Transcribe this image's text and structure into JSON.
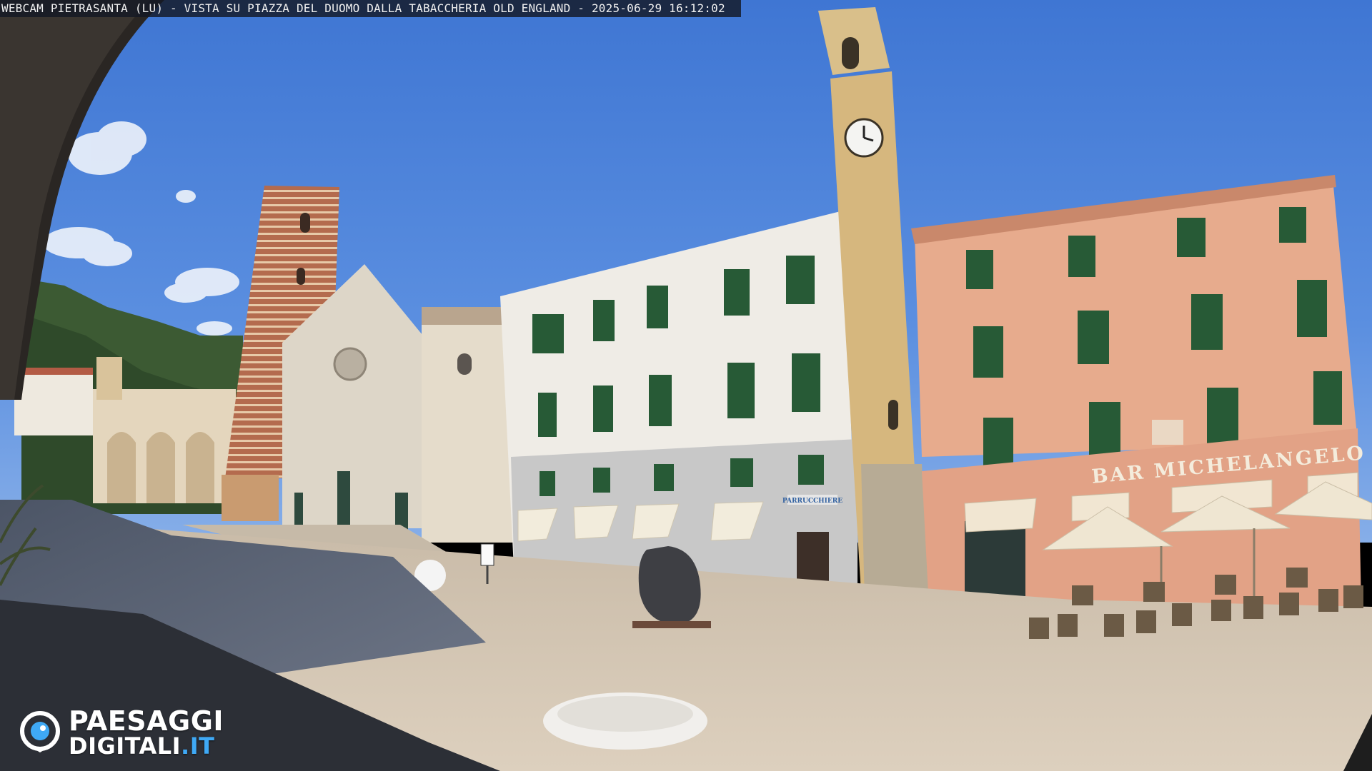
{
  "camera": {
    "caption": "WEBCAM PIETRASANTA (LU) - VISTA SU PIAZZA DEL DUOMO DALLA TABACCHERIA OLD ENGLAND - 2025-06-29 16:12:02"
  },
  "signs": {
    "bar": "BAR MICHELANGELO",
    "shop": "PARRUCCHIERE"
  },
  "logo": {
    "line1": "PAESAGGI",
    "line2_main": "DIGITALI",
    "line2_tld": ".IT"
  },
  "colors": {
    "sky": "#4a7fd6",
    "pink_building": "#e7ab8d",
    "white_building": "#efece6",
    "tower_ochre": "#d6b77e",
    "brick_tower": "#b46b4e",
    "cathedral": "#ddd6c8",
    "pavement": "#d3c5b2",
    "shutters": "#275a36",
    "logo_accent": "#3fa9f5"
  }
}
